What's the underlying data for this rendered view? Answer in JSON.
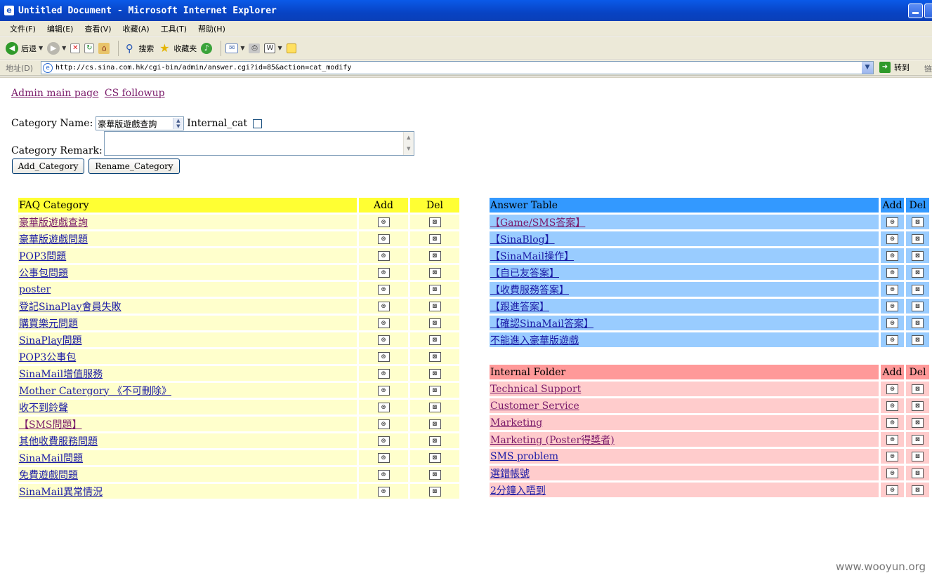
{
  "window": {
    "title": "Untitled Document - Microsoft Internet Explorer",
    "app_icon": "ie-icon"
  },
  "menu": [
    "文件(F)",
    "编辑(E)",
    "查看(V)",
    "收藏(A)",
    "工具(T)",
    "帮助(H)"
  ],
  "toolbar": {
    "back_label": "后退",
    "search_label": "搜索",
    "favorites_label": "收藏夹"
  },
  "address": {
    "label": "地址(D)",
    "url": "http://cs.sina.com.hk/cgi-bin/admin/answer.cgi?id=85&action=cat_modify",
    "go_label": "转到",
    "links_label": "链"
  },
  "page": {
    "links": [
      "Admin main page",
      "CS followup"
    ],
    "category_name_label": "Category Name:",
    "category_name_value": "豪華版遊戲查詢",
    "internal_cat_label": "Internal_cat",
    "category_remark_label": "Category Remark:",
    "category_remark_value": "",
    "add_button": "Add_Category",
    "rename_button": "Rename_Category"
  },
  "faq_table": {
    "headers": [
      "FAQ Category",
      "Add",
      "Del"
    ],
    "rows": [
      "豪華版遊戲查詢",
      "豪華版遊戲問題",
      "POP3問題",
      "公事包問題",
      "poster",
      "登記SinaPlay會員失敗",
      "購買樂元問題",
      "SinaPlay問題",
      "POP3公事包",
      "SinaMail增值服務",
      "Mother Catergory 《不可刪除》",
      "收不到鈴聲",
      "【SMS問題】",
      "其他收費服務問題",
      "SinaMail問題",
      "免費遊戲問題",
      "SinaMail異常情況"
    ]
  },
  "answer_table": {
    "headers": [
      "Answer Table",
      "Add",
      "Del"
    ],
    "rows": [
      "【Game/SMS答案】",
      "【SinaBlog】",
      "【SinaMail操作】",
      "【自已友答案】",
      "【收費服務答案】",
      "【跟進答案】",
      "【確認SinaMail答案】",
      "不能進入豪華版遊戲"
    ]
  },
  "internal_table": {
    "headers": [
      "Internal Folder",
      "Add",
      "Del"
    ],
    "rows": [
      "Technical Support",
      "Customer Service",
      "Marketing",
      "Marketing (Poster得獎者)",
      "SMS problem",
      "選錯帳號",
      "2分鐘入唔到"
    ]
  },
  "watermark": "www.wooyun.org",
  "colors": {
    "faq_header": "#ffff33",
    "faq_row": "#ffffcc",
    "answer_header": "#3399ff",
    "answer_row": "#99ccff",
    "internal_header": "#ff9999",
    "internal_row": "#ffcccc",
    "link": "#1a1aa6",
    "visited_link": "#7a1a6a"
  }
}
